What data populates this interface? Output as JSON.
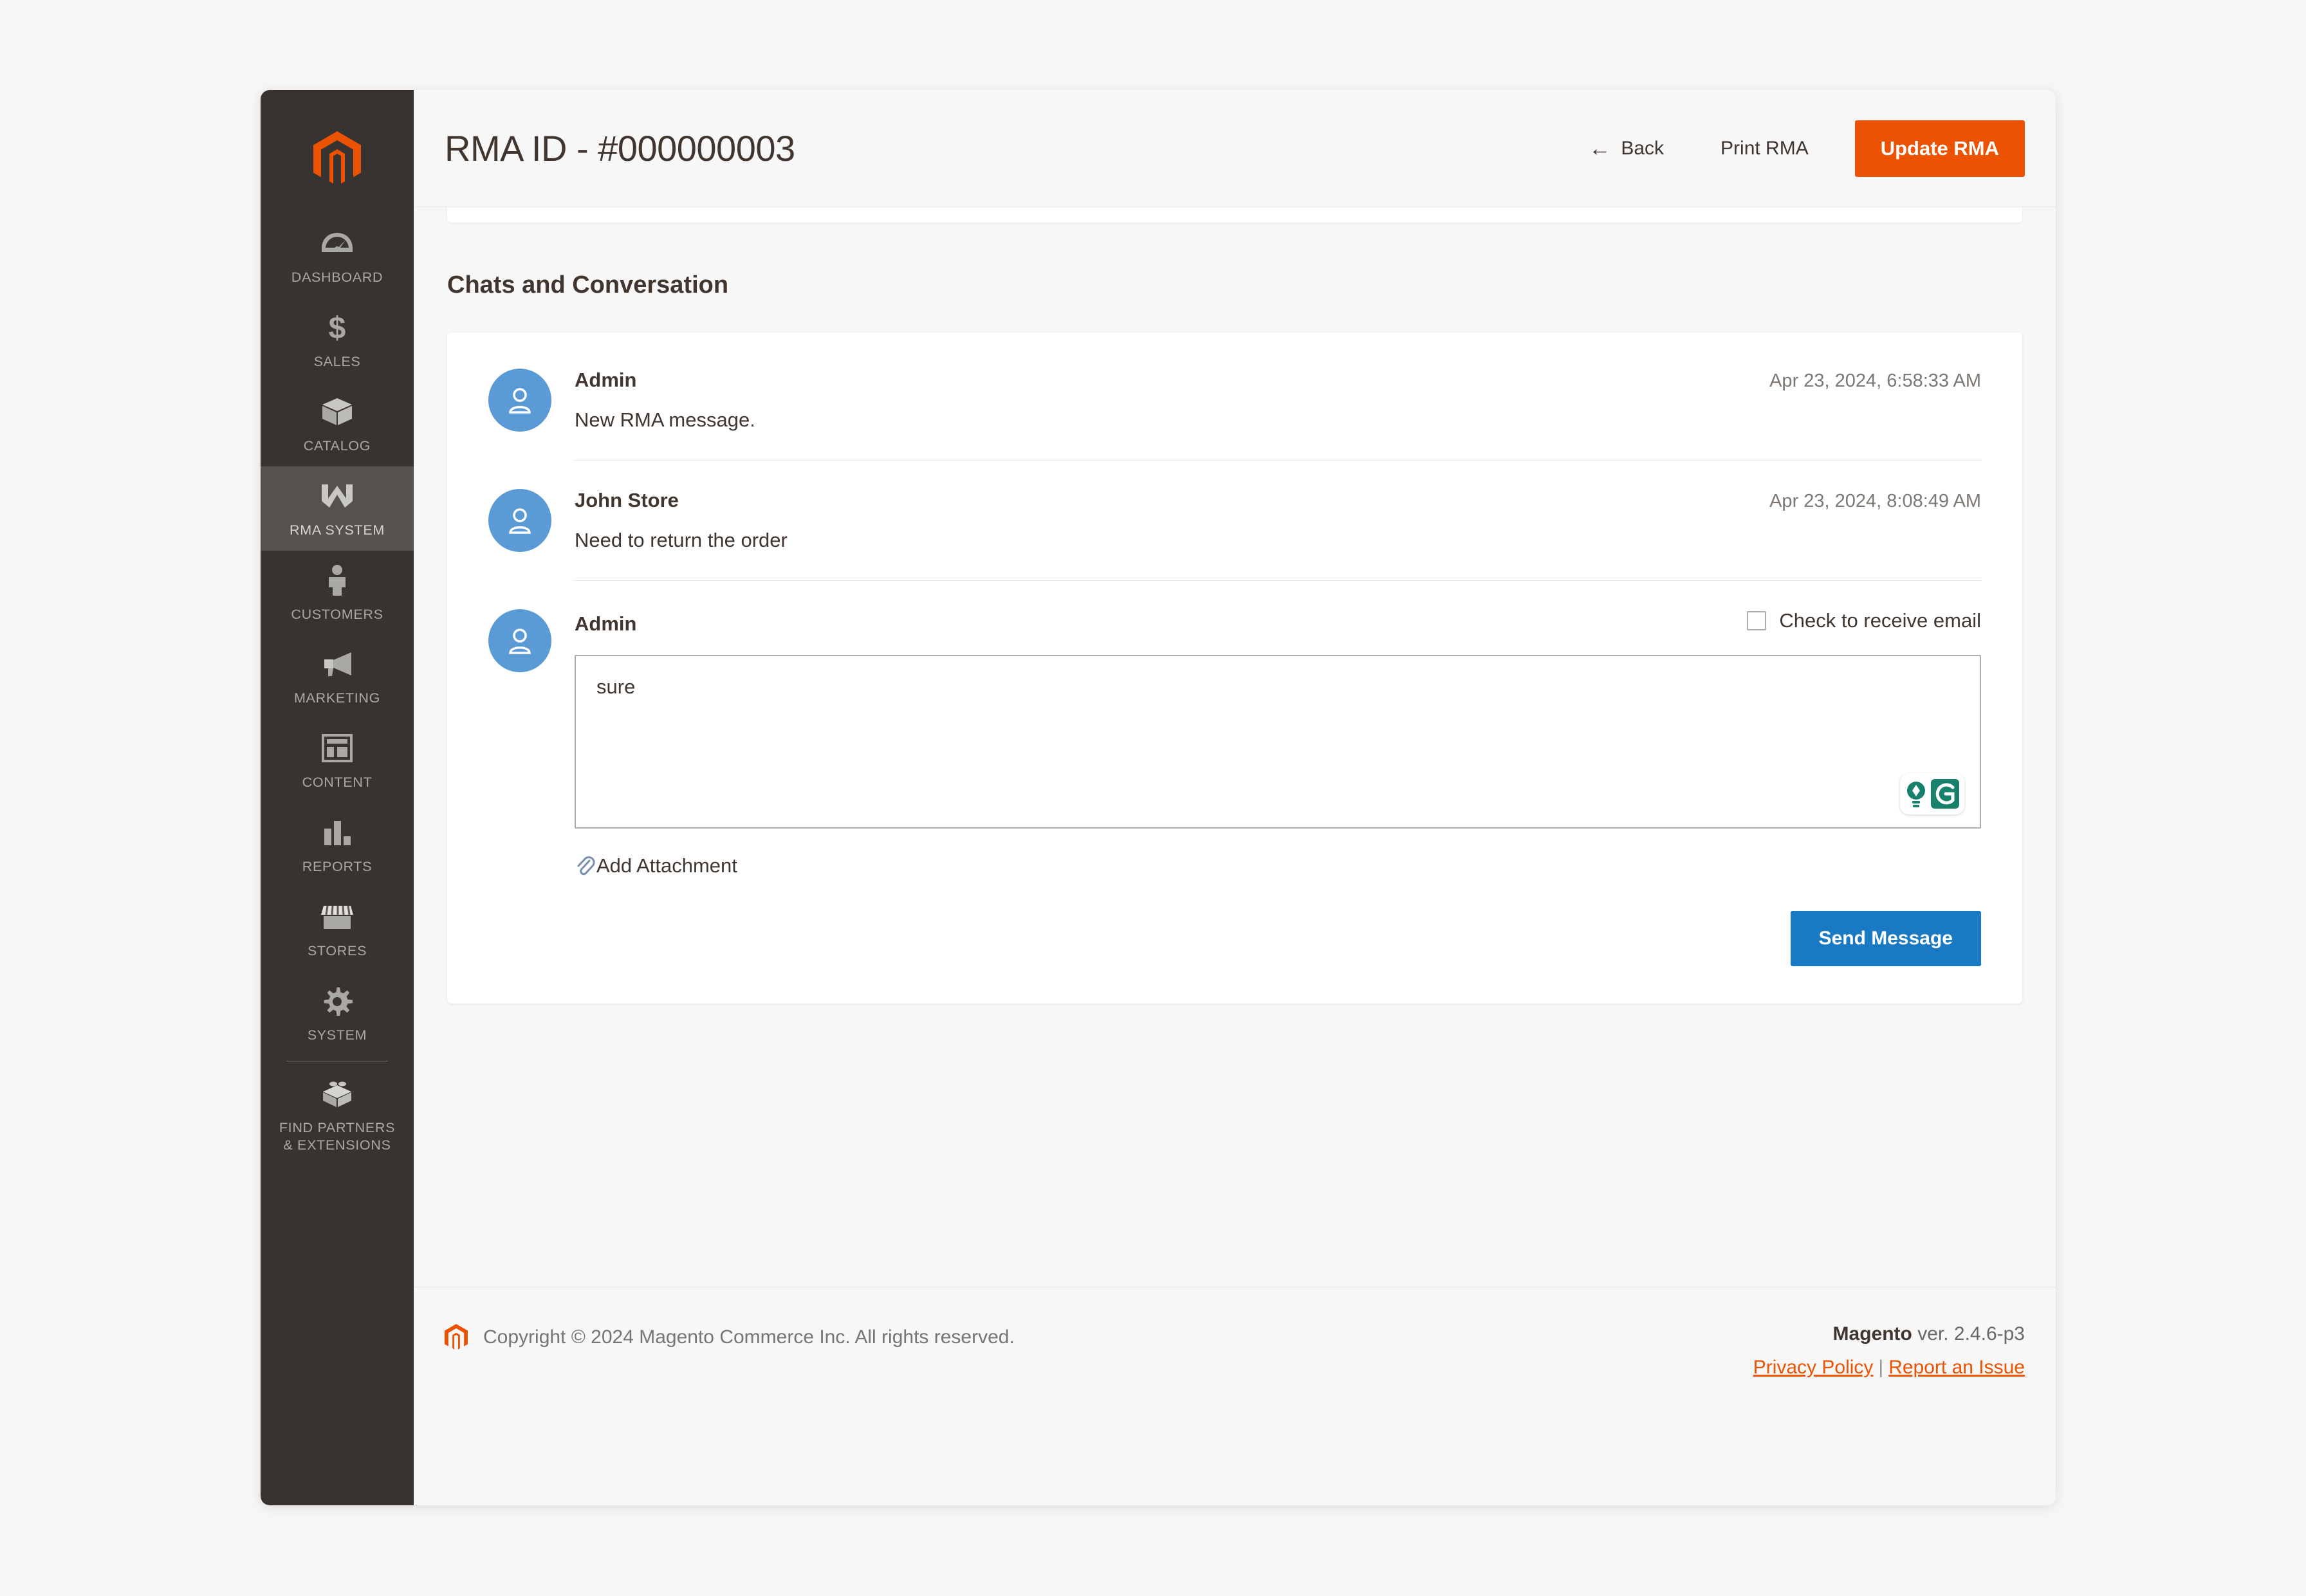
{
  "header": {
    "title": "RMA ID - #000000003",
    "back_label": "Back",
    "print_label": "Print RMA",
    "update_label": "Update RMA",
    "back_icon": "arrow-left-icon",
    "accent_color": "#eb5202"
  },
  "sidebar": {
    "logo_icon": "magento-logo-icon",
    "items": [
      {
        "label": "Dashboard",
        "icon": "dashboard-gauge-icon",
        "active": false
      },
      {
        "label": "Sales",
        "icon": "dollar-sign-icon",
        "active": false
      },
      {
        "label": "Catalog",
        "icon": "box-icon",
        "active": false
      },
      {
        "label": "RMA System",
        "icon": "rma-w-icon",
        "active": true
      },
      {
        "label": "Customers",
        "icon": "person-icon",
        "active": false
      },
      {
        "label": "Marketing",
        "icon": "megaphone-icon",
        "active": false
      },
      {
        "label": "Content",
        "icon": "layout-page-icon",
        "active": false
      },
      {
        "label": "Reports",
        "icon": "bar-chart-icon",
        "active": false
      },
      {
        "label": "Stores",
        "icon": "storefront-icon",
        "active": false
      },
      {
        "label": "System",
        "icon": "gear-icon",
        "active": false
      },
      {
        "label": "Find Partners\n& Extensions",
        "icon": "lego-brick-icon",
        "active": false
      }
    ]
  },
  "main": {
    "section_title": "Chats and Conversation",
    "messages": [
      {
        "author": "Admin",
        "timestamp": "Apr 23, 2024, 6:58:33 AM",
        "text": "New RMA message.",
        "avatar_icon": "user-avatar-icon"
      },
      {
        "author": "John Store",
        "timestamp": "Apr 23, 2024, 8:08:49 AM",
        "text": "Need to return the order",
        "avatar_icon": "user-avatar-icon"
      }
    ],
    "compose": {
      "author": "Admin",
      "avatar_icon": "user-avatar-icon",
      "checkbox_label": "Check to receive email",
      "checkbox_checked": false,
      "message_value": "sure",
      "message_placeholder": "",
      "grammarly_icons": [
        "grammarly-suggestion-icon",
        "grammarly-logo-icon"
      ],
      "attach_label": "Add Attachment",
      "attach_icon": "paperclip-icon",
      "send_label": "Send Message",
      "send_color": "#1979c3"
    }
  },
  "footer": {
    "logo_icon": "magento-logo-icon",
    "copyright": "Copyright © 2024 Magento Commerce Inc. All rights reserved.",
    "product_name": "Magento",
    "version": "ver. 2.4.6-p3",
    "privacy_label": "Privacy Policy",
    "separator": "|",
    "report_label": "Report an Issue"
  }
}
